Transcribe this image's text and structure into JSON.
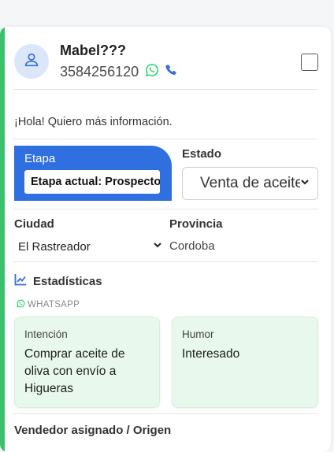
{
  "contact": {
    "name": "Mabel???",
    "phone": "3584256120",
    "message": "¡Hola! Quiero más información."
  },
  "stage": {
    "title": "Etapa",
    "current": "Etapa actual: Prospecto"
  },
  "status": {
    "label": "Estado",
    "value": "Venta de aceite"
  },
  "location": {
    "city_label": "Ciudad",
    "city_value": "El Rastreador",
    "province_label": "Provincia",
    "province_value": "Cordoba"
  },
  "stats": {
    "title": "Estadísticas",
    "source": "WHATSAPP",
    "intent_label": "Intención",
    "intent_value": "Comprar aceite de oliva con envío a Higueras",
    "mood_label": "Humor",
    "mood_value": "Interesado"
  },
  "seller": {
    "label": "Vendedor asignado / Origen"
  },
  "colors": {
    "accent_green": "#3ac16b",
    "stage_blue": "#2f6fe0",
    "whatsapp_green": "#25d366",
    "phone_blue": "#2f6fe0",
    "insight_bg": "#e8f8ec"
  },
  "icons": {
    "avatar": "user-icon",
    "whatsapp": "whatsapp-icon",
    "phone": "phone-icon",
    "stats": "chart-line-icon",
    "chevron": "chevron-down-icon"
  }
}
